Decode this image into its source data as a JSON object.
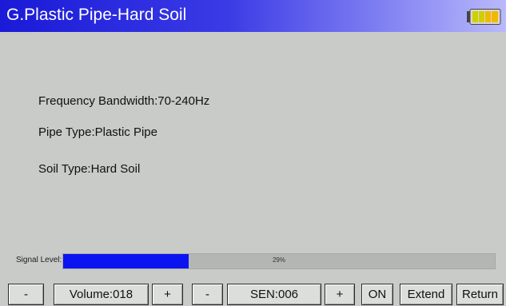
{
  "header": {
    "title": "G.Plastic Pipe-Hard Soil",
    "battery_icon": "battery-icon"
  },
  "info": {
    "frequency": "Frequency Bandwidth:70-240Hz",
    "pipe_type": "Pipe Type:Plastic Pipe",
    "soil_type": "Soil Type:Hard Soil"
  },
  "signal": {
    "label": "Signal Level:",
    "percent_text": "29%",
    "level": 0.29,
    "color": "#0a14f0"
  },
  "toolbar": {
    "volume_minus": "-",
    "volume": "Volume:018",
    "volume_plus": "+",
    "sen_minus": "-",
    "sen": "SEN:006",
    "sen_plus": "+",
    "on": "ON",
    "extend": "Extend",
    "return": "Return"
  },
  "colors": {
    "title_bar": "#1a1ad8",
    "background": "#c9cbc8"
  }
}
